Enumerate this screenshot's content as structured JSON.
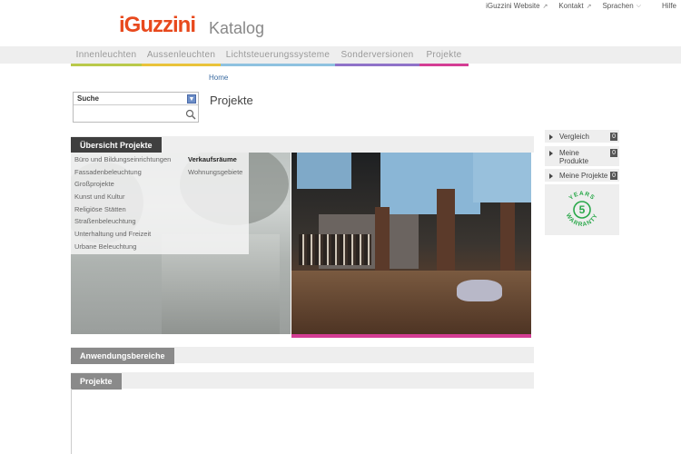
{
  "toplinks": {
    "website": "iGuzzini Website",
    "kontakt": "Kontakt",
    "sprachen": "Sprachen",
    "hilfe": "Hilfe"
  },
  "header": {
    "logo": "iGuzzini",
    "title": "Katalog"
  },
  "nav": [
    {
      "label": "Innenleuchten",
      "color": "#b9c94a",
      "width": 78
    },
    {
      "label": "Aussenleuchten",
      "color": "#e9c33a",
      "width": 87
    },
    {
      "label": "Lichtsteuerungssysteme",
      "color": "#8ec2e0",
      "width": 126
    },
    {
      "label": "Sonderversionen",
      "color": "#8f72c8",
      "width": 93
    },
    {
      "label": "Projekte",
      "color": "#d43d94",
      "width": 54
    }
  ],
  "breadcrumb": "Home",
  "search": {
    "selected": "Suche"
  },
  "page_title": "Projekte",
  "sections": {
    "overview": "Übersicht Projekte",
    "anwendung": "Anwendungsbereiche",
    "projekte": "Projekte"
  },
  "menu": {
    "col1": [
      "Büro und Bildungseinrichtungen",
      "Fassadenbeleuchtung",
      "Großprojekte",
      "Kunst und Kultur",
      "Religiöse Stätten",
      "Straßenbeleuchtung",
      "Unterhaltung und Freizeit",
      "Urbane Beleuchtung"
    ],
    "col2": [
      "Verkaufsräume",
      "Wohnungsgebiete"
    ]
  },
  "sidebar": {
    "vergleich": {
      "label": "Vergleich",
      "count": "0"
    },
    "produkte": {
      "label": "Meine Produkte",
      "count": "0"
    },
    "projekte": {
      "label": "Meine Projekte",
      "count": "0"
    }
  },
  "warranty": {
    "top": "YEARS",
    "number": "5",
    "bottom": "WARRANTY",
    "color": "#2aa84a"
  }
}
